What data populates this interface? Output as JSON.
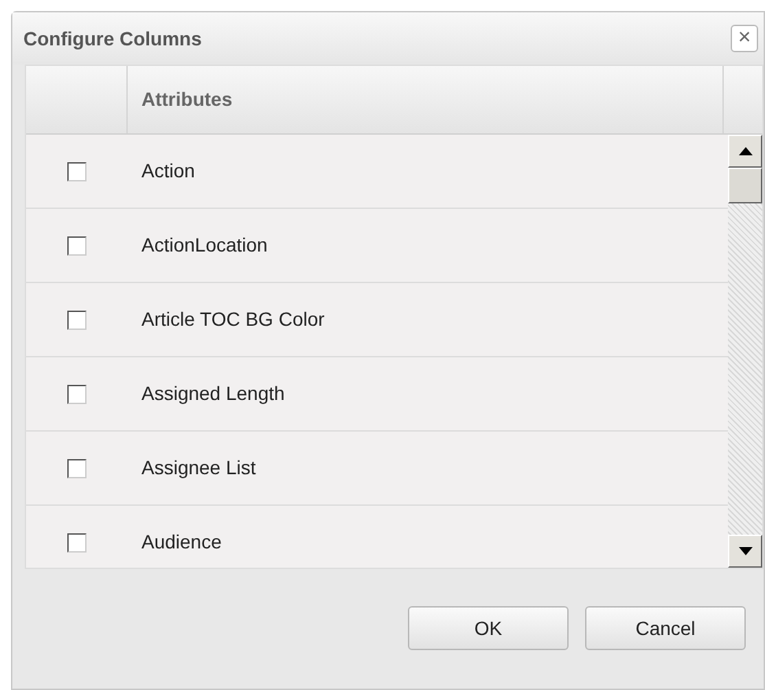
{
  "window": {
    "title": "Configure Columns",
    "close": "×"
  },
  "table": {
    "columns": [
      "Attributes"
    ],
    "rows": [
      {
        "label": "Action",
        "checked": false
      },
      {
        "label": "ActionLocation",
        "checked": false
      },
      {
        "label": "Article TOC BG Color",
        "checked": false
      },
      {
        "label": "Assigned Length",
        "checked": false
      },
      {
        "label": "Assignee List",
        "checked": false
      },
      {
        "label": "Audience",
        "checked": false
      }
    ]
  },
  "buttons": [
    "OK",
    "Cancel"
  ]
}
